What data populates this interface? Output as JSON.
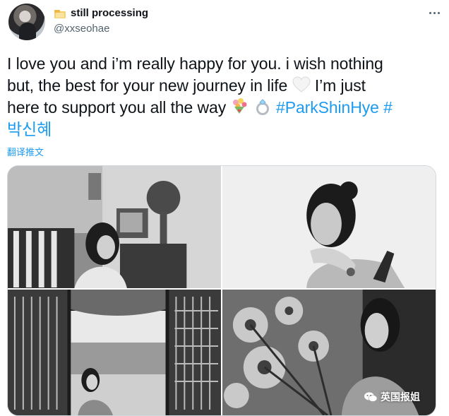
{
  "author": {
    "display_name": "still processing",
    "handle": "@xxseohae"
  },
  "tweet": {
    "text_line1": "I love you and i’m really happy for you. i wish nothing",
    "text_line2a": "but, the best for your new journey in life",
    "text_line2b": " I’m just",
    "text_line3": "here to support you all the way",
    "hashtag1": "#ParkShinHye",
    "hashtag2": "#",
    "hashtag2_korean": "박신혜",
    "translate_label": "翻译推文"
  },
  "media": {
    "count": 4,
    "watermark": "英国报姐"
  },
  "colors": {
    "accent": "#1d9bf0",
    "text": "#0f1419",
    "secondary_text": "#536471",
    "border": "#cfd9de"
  },
  "icons": {
    "name_emoji": "folder-emoji",
    "heart": "white-heart-emoji",
    "flowers": "bouquet-emoji",
    "ring": "ring-emoji",
    "more": "more-dots-icon",
    "watermark": "wechat-icon"
  }
}
